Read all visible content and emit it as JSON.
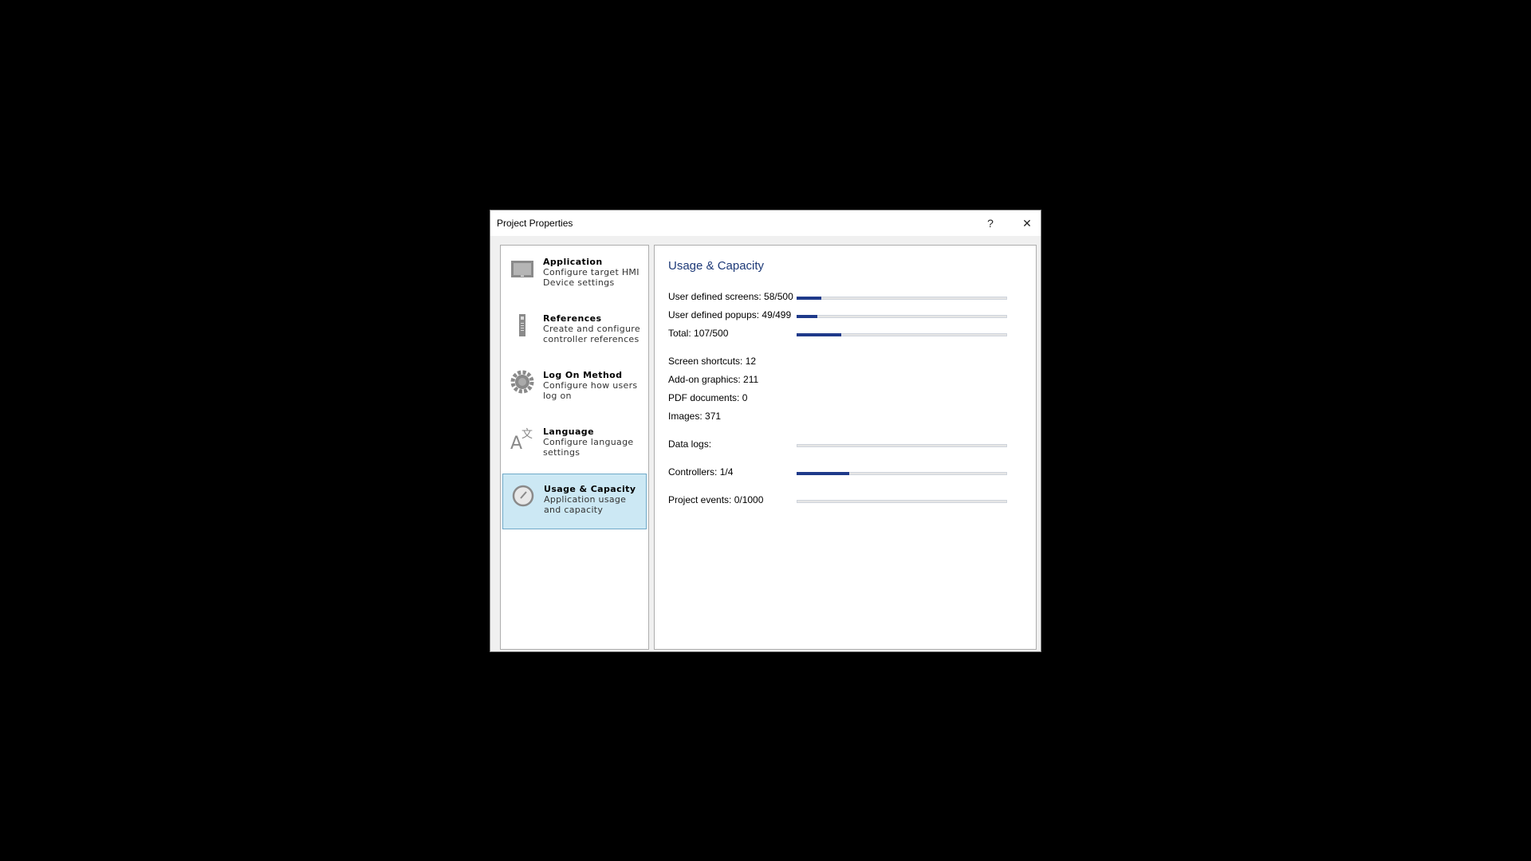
{
  "window": {
    "title": "Project Properties",
    "help_label": "?",
    "close_label": "✕"
  },
  "sidebar": {
    "items": [
      {
        "title": "Application",
        "desc": "Configure target HMI Device settings",
        "icon": "monitor-icon"
      },
      {
        "title": "References",
        "desc": "Create and configure controller references",
        "icon": "controller-icon"
      },
      {
        "title": "Log On Method",
        "desc": "Configure how users log on",
        "icon": "gear-icon"
      },
      {
        "title": "Language",
        "desc": "Configure language settings",
        "icon": "language-icon"
      },
      {
        "title": "Usage & Capacity",
        "desc": "Application usage and capacity",
        "icon": "gauge-icon",
        "selected": true
      }
    ]
  },
  "main": {
    "heading": "Usage & Capacity",
    "bar_color": "#1f3a8a",
    "rows": [
      {
        "label": "User defined screens: 58/500",
        "progress": 0.116
      },
      {
        "label": "User defined popups: 49/499",
        "progress": 0.098
      },
      {
        "label": "Total: 107/500",
        "progress": 0.214
      },
      {
        "label": "Screen shortcuts: 12"
      },
      {
        "label": "Add-on graphics: 211"
      },
      {
        "label": "PDF documents: 0"
      },
      {
        "label": "Images: 371"
      },
      {
        "label": "Data logs:",
        "progress": 0
      },
      {
        "label": "Controllers: 1/4",
        "progress": 0.25
      },
      {
        "label": "Project events: 0/1000",
        "progress": 0
      }
    ]
  }
}
